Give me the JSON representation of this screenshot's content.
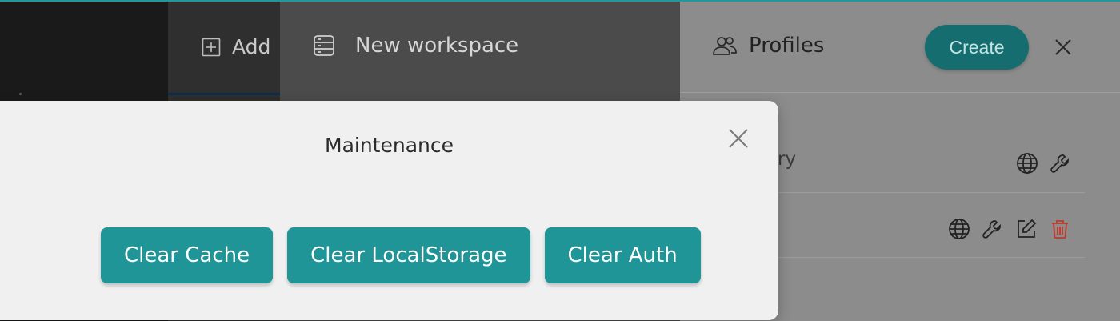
{
  "background_app": {
    "sidebar_action_label": "Add",
    "workspace_panel": {
      "title": "New workspace",
      "icon": "database-icon"
    },
    "profiles_panel": {
      "title": "Profiles",
      "icon": "users-icon",
      "create_label": "Create",
      "rows": [
        {
          "name_partial": "ry",
          "icons": [
            "globe-icon",
            "wrench-icon"
          ]
        },
        {
          "name_partial": "",
          "icons": [
            "globe-icon",
            "wrench-icon",
            "edit-icon",
            "trash-icon"
          ]
        }
      ]
    }
  },
  "modal": {
    "title": "Maintenance",
    "buttons": {
      "clear_cache": "Clear Cache",
      "clear_localstorage": "Clear LocalStorage",
      "clear_auth": "Clear Auth"
    }
  },
  "colors": {
    "accent": "#1f9597",
    "create_button": "#166d70",
    "delete": "#c0392b"
  }
}
